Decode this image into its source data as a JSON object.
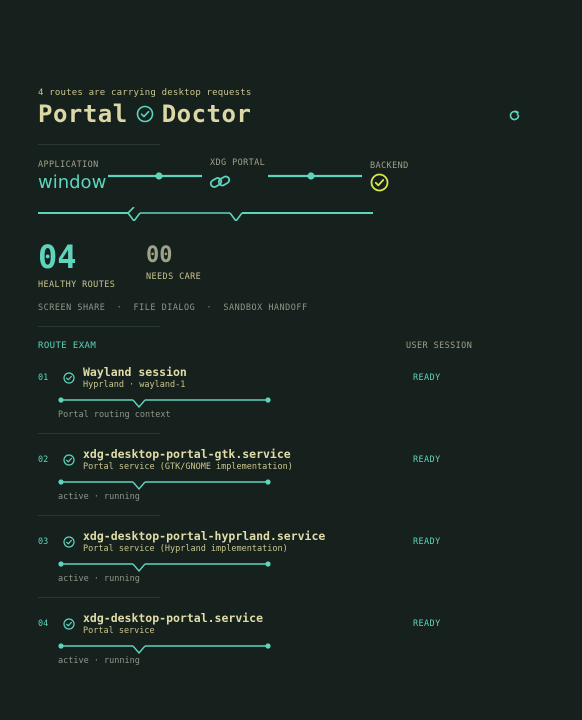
{
  "header": {
    "subtitle": "4 routes are carrying desktop requests",
    "title_left": "Portal",
    "title_right": "Doctor"
  },
  "pipeline": {
    "application_label": "APPLICATION",
    "application_value": "window",
    "portal_label": "XDG PORTAL",
    "backend_label": "BACKEND"
  },
  "stats": {
    "healthy_value": "04",
    "healthy_label": "HEALTHY ROUTES",
    "care_value": "00",
    "care_label": "NEEDS CARE"
  },
  "capabilities": "SCREEN SHARE  ·  FILE DIALOG  ·  SANDBOX HANDOFF",
  "routes_header": {
    "left": "ROUTE EXAM",
    "right": "USER SESSION"
  },
  "routes": [
    {
      "num": "01",
      "title": "Wayland session",
      "sub": "Hyprland · wayland-1",
      "note": "Portal routing context",
      "status": "READY"
    },
    {
      "num": "02",
      "title": "xdg-desktop-portal-gtk.service",
      "sub": "Portal service (GTK/GNOME implementation)",
      "note": "active · running",
      "status": "READY"
    },
    {
      "num": "03",
      "title": "xdg-desktop-portal-hyprland.service",
      "sub": "Portal service (Hyprland implementation)",
      "note": "active · running",
      "status": "READY"
    },
    {
      "num": "04",
      "title": "xdg-desktop-portal.service",
      "sub": "Portal service",
      "note": "active · running",
      "status": "READY"
    }
  ],
  "colors": {
    "accent": "#5fd4bd",
    "title": "#dcd8a6",
    "check_backend": "#d8e84a",
    "bg": "#16201d"
  },
  "icons": {
    "title": "check-circle-icon",
    "refresh": "refresh-icon",
    "portal": "link-icon",
    "backend": "check-circle-icon"
  }
}
